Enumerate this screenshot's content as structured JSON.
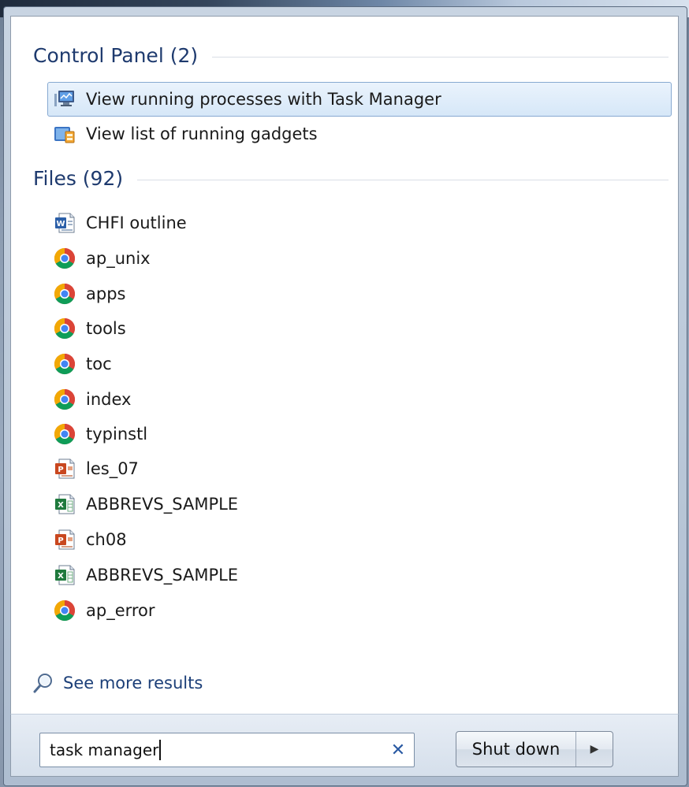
{
  "groups": {
    "control_panel": {
      "header": "Control Panel (2)",
      "items": [
        {
          "label": "View running processes with Task Manager",
          "icon": "task-manager-icon"
        },
        {
          "label": "View list of running gadgets",
          "icon": "gadgets-icon"
        }
      ]
    },
    "files": {
      "header": "Files (92)",
      "items": [
        {
          "label": "CHFI outline",
          "icon": "word-document-icon"
        },
        {
          "label": "ap_unix",
          "icon": "chrome-icon"
        },
        {
          "label": "apps",
          "icon": "chrome-icon"
        },
        {
          "label": "tools",
          "icon": "chrome-icon"
        },
        {
          "label": "toc",
          "icon": "chrome-icon"
        },
        {
          "label": "index",
          "icon": "chrome-icon"
        },
        {
          "label": "typinstl",
          "icon": "chrome-icon"
        },
        {
          "label": "les_07",
          "icon": "powerpoint-icon"
        },
        {
          "label": "ABBREVS_SAMPLE",
          "icon": "excel-icon"
        },
        {
          "label": "ch08",
          "icon": "powerpoint-icon"
        },
        {
          "label": "ABBREVS_SAMPLE",
          "icon": "excel-icon"
        },
        {
          "label": "ap_error",
          "icon": "chrome-icon"
        }
      ]
    }
  },
  "see_more": {
    "label": "See more results",
    "icon": "search-icon"
  },
  "search": {
    "value": "task manager",
    "clear_icon": "close-icon"
  },
  "shutdown": {
    "label": "Shut down",
    "arrow_icon": "chevron-right-icon"
  },
  "colors": {
    "header_text": "#1e3a6e",
    "selection_border": "#87a9d1",
    "link_text": "#1c3f78"
  }
}
